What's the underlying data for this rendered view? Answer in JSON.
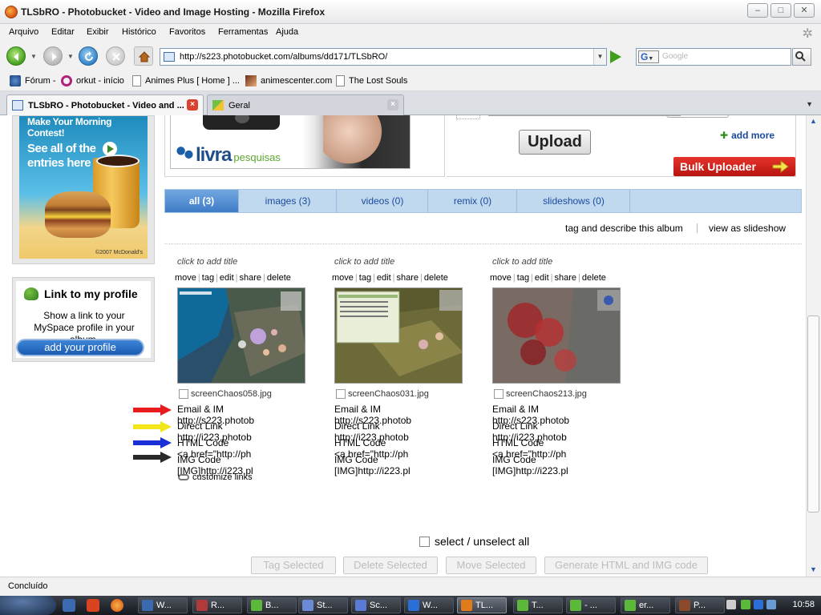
{
  "window": {
    "title": "TLSbRO - Photobucket - Video and Image Hosting - Mozilla Firefox",
    "buttons": [
      "–",
      "□",
      "✕"
    ]
  },
  "menu": [
    "Arquivo",
    "Editar",
    "Exibir",
    "Histórico",
    "Favoritos",
    "Ferramentas",
    "Ajuda"
  ],
  "nav": {
    "url": "http://s223.photobucket.com/albums/dd171/TLSbRO/",
    "search_placeholder": "Google",
    "search_engine_letter": "G"
  },
  "bookmarks": [
    {
      "label": "Fórum -",
      "icon": "fav-icon"
    },
    {
      "label": "orkut - início",
      "icon": "orkut-icon"
    },
    {
      "label": "Animes Plus [ Home ] ...",
      "icon": "page-icon"
    },
    {
      "label": "animescenter.com",
      "icon": "image-icon"
    },
    {
      "label": "The Lost Souls",
      "icon": "page-icon"
    }
  ],
  "tabs": [
    {
      "label": "TLSbRO - Photobucket - Video and ...",
      "active": true
    },
    {
      "label": "Geral",
      "active": false
    }
  ],
  "sidebar": {
    "ad": {
      "line1": "Make Your Morning Contest!",
      "line2": "See all of the entries here",
      "copyright": "©2007 McDonald's"
    },
    "profile": {
      "heading": "Link to my profile",
      "text": "Show a link to your MySpace profile in your album.",
      "button": "add your profile"
    }
  },
  "banner": {
    "brand": "livra",
    "brand_suffix": "pesquisas"
  },
  "upload": {
    "button": "Upload",
    "add_more": "add more",
    "bulk": "Bulk Uploader"
  },
  "filter_tabs": [
    {
      "label": "all (3)",
      "active": true
    },
    {
      "label": "images (3)",
      "active": false
    },
    {
      "label": "videos (0)",
      "active": false
    },
    {
      "label": "remix (0)",
      "active": false
    },
    {
      "label": "slideshows (0)",
      "active": false
    }
  ],
  "album_links": {
    "tag": "tag and describe this album",
    "slideshow": "view as slideshow"
  },
  "card_common": {
    "title": "click to add title",
    "actions": [
      "move",
      "tag",
      "edit",
      "share",
      "delete"
    ],
    "link_labels": [
      "Email & IM",
      "Direct Link",
      "HTML Code",
      "IMG Code"
    ]
  },
  "photos": [
    {
      "filename": "screenChaos058.jpg",
      "links": [
        "http://s223.photob",
        "http://i223.photob",
        "<a href=\"http://ph",
        "[IMG]http://i223.pl"
      ]
    },
    {
      "filename": "screenChaos031.jpg",
      "links": [
        "http://s223.photob",
        "http://i223.photob",
        "<a href=\"http://ph",
        "[IMG]http://i223.pl"
      ]
    },
    {
      "filename": "screenChaos213.jpg",
      "links": [
        "http://s223.photob",
        "http://i223.photob",
        "<a href=\"http://ph",
        "[IMG]http://i223.pl"
      ]
    }
  ],
  "customize_links": "customize links",
  "annotation_arrow_colors": [
    "#e81c1c",
    "#f2e61a",
    "#1a2fd6",
    "#2a2a2a"
  ],
  "select_all": "select / unselect all",
  "bulk_actions": [
    "Tag Selected",
    "Delete Selected",
    "Move Selected",
    "Generate HTML and IMG code"
  ],
  "status": "Concluído",
  "taskbar": {
    "tasks": [
      "W...",
      "R...",
      "B...",
      "St...",
      "Sc...",
      "W...",
      "TL...",
      "T...",
      "- ...",
      "er...",
      "P..."
    ],
    "active_index": 6,
    "clock": "10:58"
  }
}
